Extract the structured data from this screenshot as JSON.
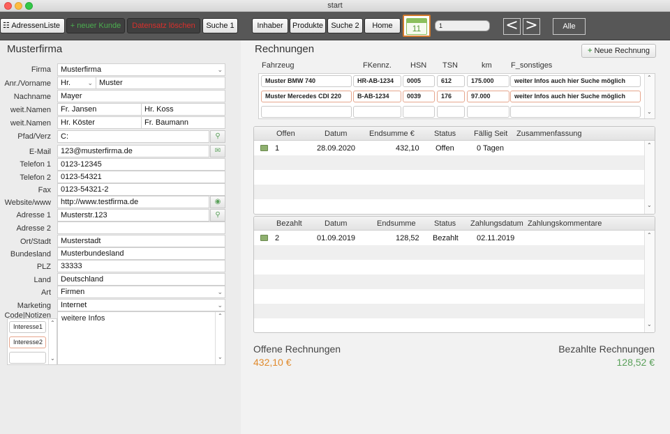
{
  "window": {
    "title": "start"
  },
  "toolbar": {
    "adressen": "AdressenListe",
    "neuer_kunde": "+ neuer Kunde",
    "loeschen": "Datensatz löschen",
    "suche1": "Suche 1",
    "inhaber": "Inhaber",
    "produkte": "Produkte",
    "suche2": "Suche 2",
    "home": "Home",
    "calendar_day": "11",
    "record_field": "1",
    "prev": "<",
    "next": ">",
    "alle": "Alle"
  },
  "form": {
    "title": "Musterfirma",
    "labels": {
      "firma": "Firma",
      "anrede": "Anr./Vorname",
      "nachname": "Nachname",
      "weit1": "weit.Namen",
      "weit2": "weit.Namen",
      "pfad": "Pfad/Verz",
      "email": "E-Mail",
      "tel1": "Telefon 1",
      "tel2": "Telefon 2",
      "fax": "Fax",
      "web": "Website/www",
      "adr1": "Adresse 1",
      "adr2": "Adresse 2",
      "ort": "Ort/Stadt",
      "bundesland": "Bundesland",
      "plz": "PLZ",
      "land": "Land",
      "art": "Art",
      "marketing": "Marketing",
      "code": "Code|Notizen"
    },
    "values": {
      "firma": "Musterfirma",
      "anrede": "Hr.",
      "vorname": "Muster",
      "nachname": "Mayer",
      "weit1a": "Fr. Jansen",
      "weit1b": "Hr. Koss",
      "weit2a": "Hr. Köster",
      "weit2b": "Fr. Baumann",
      "pfad": "C:",
      "email": "123@musterfirma.de",
      "tel1": "0123-12345",
      "tel2": "0123-54321",
      "fax": "0123-54321-2",
      "web": "http://www.testfirma.de",
      "adr1": "Musterstr.123",
      "adr2": "",
      "ort": "Musterstadt",
      "bundesland": "Musterbundesland",
      "plz": "33333",
      "land": "Deutschland",
      "art": "Firmen",
      "marketing": "Internet",
      "notizen": "weitere Infos",
      "interesse1": "Interesse1",
      "interesse2": "Interesse2"
    }
  },
  "rechnungen": {
    "title": "Rechnungen",
    "neue_button": "Neue Rechnung",
    "vehicle_headers": [
      "Fahrzeug",
      "FKennz.",
      "HSN",
      "TSN",
      "km",
      "F_sonstiges"
    ],
    "vehicles": [
      [
        "Muster BMW 740",
        "HR-AB-1234",
        "0005",
        "612",
        "175.000",
        "weiter Infos auch hier Suche möglich"
      ],
      [
        "Muster Mercedes CDI 220",
        "B-AB-1234",
        "0039",
        "176",
        "97.000",
        "weiter Infos auch hier Suche möglich"
      ]
    ],
    "offen_headers": [
      "Offen",
      "Datum",
      "Endsumme  €",
      "Status",
      "Fällig Seit",
      "Zusammenfassung"
    ],
    "offen_rows": [
      [
        "1",
        "28.09.2020",
        "432,10",
        "Offen",
        "0 Tagen",
        ""
      ]
    ],
    "bezahlt_headers": [
      "Bezahlt",
      "Datum",
      "Endsumme",
      "Status",
      "Zahlungsdatum",
      "Zahlungskommentare"
    ],
    "bezahlt_rows": [
      [
        "2",
        "01.09.2019",
        "128,52",
        "Bezahlt",
        "02.11.2019",
        ""
      ]
    ],
    "offene_label": "Offene Rechnungen",
    "offene_sum": "432,10 €",
    "bezahlte_label": "Bezahlte Rechnungen",
    "bezahlte_sum": "128,52 €"
  },
  "colors": {
    "accent_orange": "#e08a2c",
    "accent_green": "#5aa05a",
    "toolbar": "#575757"
  }
}
